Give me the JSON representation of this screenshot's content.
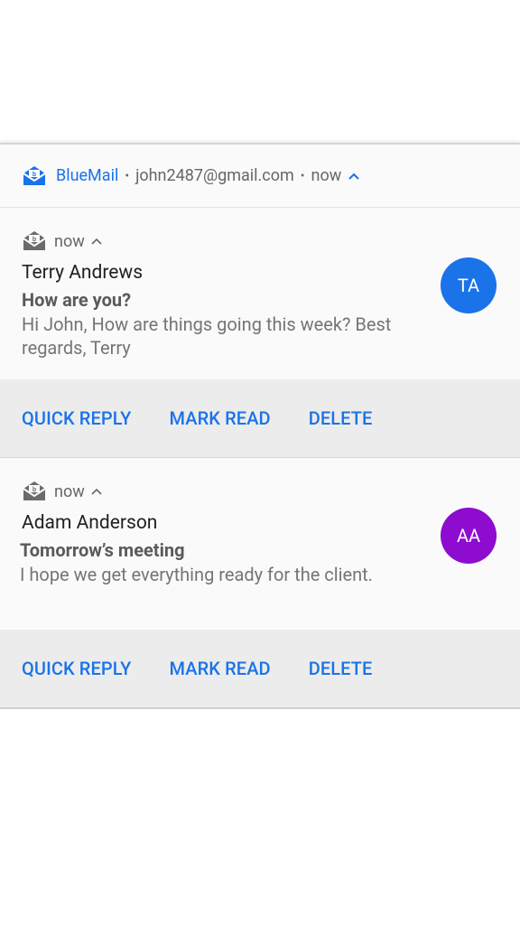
{
  "group": {
    "app_name": "BlueMail",
    "separator": "•",
    "account": "john2487@gmail.com",
    "time": "now",
    "app_icon": "bluemail-envelope-icon",
    "accent_color": "#1a73e8"
  },
  "notifications": [
    {
      "time": "now",
      "sender": "Terry Andrews",
      "subject": "How are you?",
      "preview": "Hi John, How are things going this week? Best regards, Terry",
      "avatar_initials": "TA",
      "avatar_color": "#1a73e8",
      "actions": [
        "QUICK REPLY",
        "MARK READ",
        "DELETE"
      ]
    },
    {
      "time": "now",
      "sender": "Adam Anderson",
      "subject": "Tomorrow’s meeting",
      "preview": "I hope we get everything ready for the client.",
      "avatar_initials": "AA",
      "avatar_color": "#8e0ccf",
      "actions": [
        "QUICK REPLY",
        "MARK READ",
        "DELETE"
      ]
    }
  ]
}
